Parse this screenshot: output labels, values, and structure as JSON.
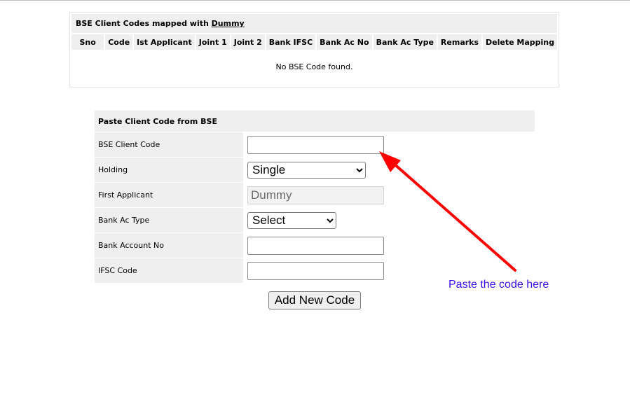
{
  "mapped": {
    "caption_prefix": "BSE Client Codes mapped with ",
    "client_name": "Dummy",
    "columns": [
      "Sno",
      "Code",
      "Ist Applicant",
      "Joint 1",
      "Joint 2",
      "Bank IFSC",
      "Bank Ac No",
      "Bank Ac Type",
      "Remarks",
      "Delete Mapping"
    ],
    "empty_message": "No BSE Code found."
  },
  "form": {
    "title": "Paste Client Code from BSE",
    "bse_client_code": {
      "label": "BSE Client Code",
      "value": ""
    },
    "holding": {
      "label": "Holding",
      "selected": "Single"
    },
    "first_applicant": {
      "label": "First Applicant",
      "value": "Dummy"
    },
    "bank_ac_type": {
      "label": "Bank Ac Type",
      "selected": "Select"
    },
    "bank_account_no": {
      "label": "Bank Account No",
      "value": ""
    },
    "ifsc_code": {
      "label": "IFSC Code",
      "value": ""
    },
    "submit_label": "Add New Code"
  },
  "annotation": {
    "text": "Paste the code here",
    "arrow_color": "#ff0000",
    "text_color": "#3b10e8"
  }
}
